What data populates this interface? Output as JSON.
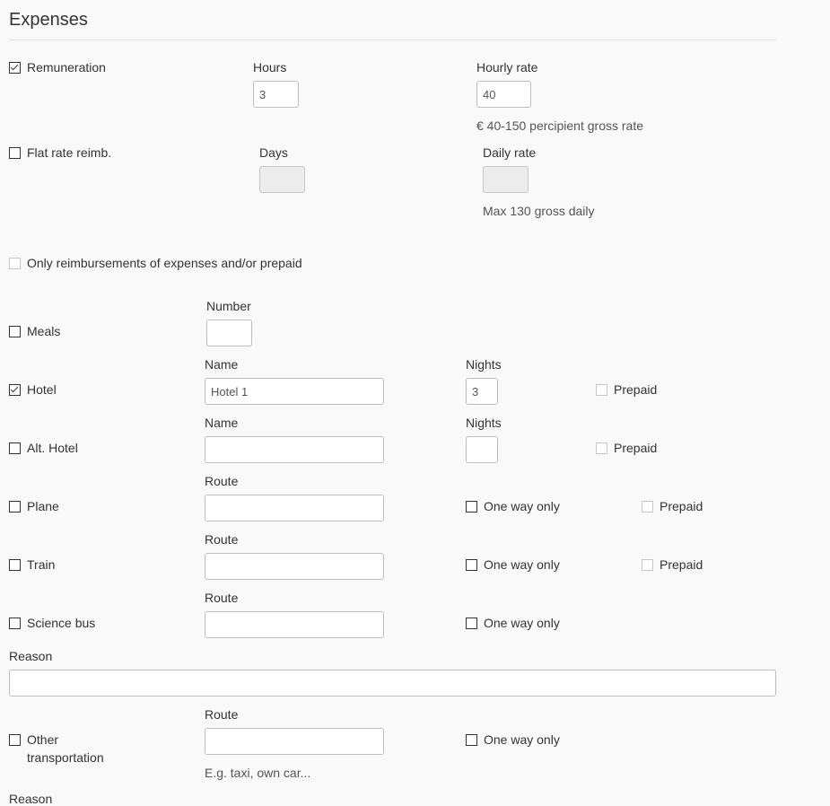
{
  "page": {
    "title": "Expenses"
  },
  "remuneration": {
    "label": "Remuneration",
    "checked": true,
    "hours_label": "Hours",
    "hours_value": "3",
    "rate_label": "Hourly rate",
    "rate_value": "40",
    "help": "€ 40-150 percipient gross rate"
  },
  "flat_rate": {
    "label": "Flat rate reimb.",
    "checked": false,
    "days_label": "Days",
    "days_value": "",
    "rate_label": "Daily rate",
    "rate_value": "",
    "help": "Max 130 gross daily"
  },
  "only_reimbursements": {
    "label": "Only reimbursements of expenses and/or prepaid",
    "checked": false
  },
  "meals": {
    "label": "Meals",
    "number_label": "Number",
    "number_value": ""
  },
  "hotel": {
    "label": "Hotel",
    "checked": true,
    "name_label": "Name",
    "name_value": "Hotel 1",
    "nights_label": "Nights",
    "nights_value": "3",
    "prepaid_label": "Prepaid"
  },
  "alt_hotel": {
    "label": "Alt. Hotel",
    "name_label": "Name",
    "name_value": "",
    "nights_label": "Nights",
    "nights_value": "",
    "prepaid_label": "Prepaid"
  },
  "plane": {
    "label": "Plane",
    "route_label": "Route",
    "route_value": "",
    "one_way_label": "One way only",
    "prepaid_label": "Prepaid"
  },
  "train": {
    "label": "Train",
    "route_label": "Route",
    "route_value": "",
    "one_way_label": "One way only",
    "prepaid_label": "Prepaid"
  },
  "science_bus": {
    "label": "Science bus",
    "route_label": "Route",
    "route_value": "",
    "one_way_label": "One way only",
    "reason_label": "Reason",
    "reason_value": ""
  },
  "other_transport": {
    "label_line1": "Other",
    "label_line2": "transportation",
    "route_label": "Route",
    "route_placeholder": "E.g. taxi, own car...",
    "route_value": "",
    "one_way_label": "One way only",
    "reason_label": "Reason"
  }
}
